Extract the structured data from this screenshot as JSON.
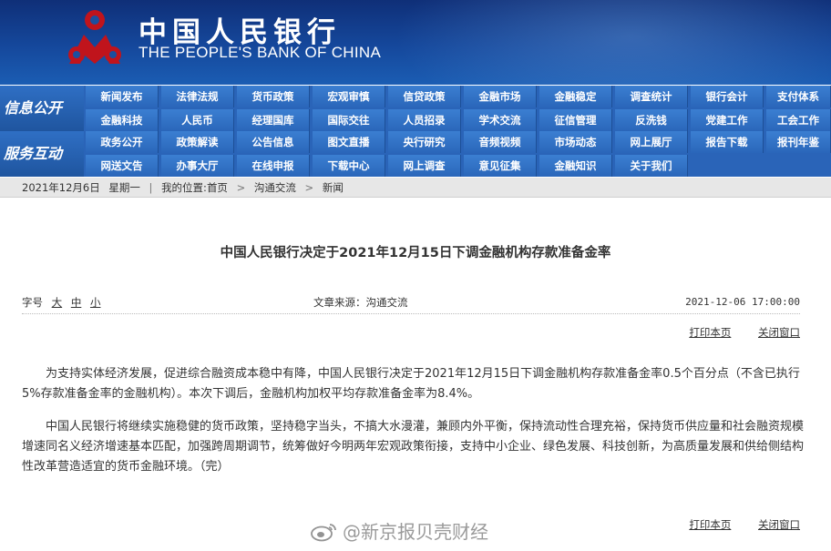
{
  "header": {
    "logo_cn": "中国人民银行",
    "logo_en": "THE PEOPLE'S BANK OF CHINA",
    "emblem_icon": "pboc-emblem-icon",
    "brand_color": "#c0141c",
    "banner_color": "#15489c"
  },
  "nav": {
    "sections": [
      {
        "title": "信息公开",
        "rows": [
          [
            "新闻发布",
            "法律法规",
            "货币政策",
            "宏观审慎",
            "信贷政策",
            "金融市场",
            "金融稳定",
            "调查统计",
            "银行会计",
            "支付体系"
          ],
          [
            "金融科技",
            "人民币",
            "经理国库",
            "国际交往",
            "人员招录",
            "学术交流",
            "征信管理",
            "反洗钱",
            "党建工作",
            "工会工作"
          ]
        ]
      },
      {
        "title": "服务互动",
        "rows": [
          [
            "政务公开",
            "政策解读",
            "公告信息",
            "图文直播",
            "央行研究",
            "音频视频",
            "市场动态",
            "网上展厅",
            "报告下载",
            "报刊年鉴"
          ],
          [
            "网送文告",
            "办事大厅",
            "在线申报",
            "下载中心",
            "网上调查",
            "意见征集",
            "金融知识",
            "关于我们"
          ]
        ]
      }
    ]
  },
  "breadcrumb": {
    "date": "2021年12月6日",
    "weekday": "星期一",
    "location_label": "我的位置:",
    "home": "首页",
    "section": "沟通交流",
    "page": "新闻"
  },
  "article": {
    "title": "中国人民银行决定于2021年12月15日下调金融机构存款准备金率",
    "font_size_label": "字号",
    "font_sizes": [
      "大",
      "中",
      "小"
    ],
    "source": "文章来源：沟通交流",
    "timestamp": "2021-12-06 17:00:00",
    "print_label": "打印本页",
    "close_label": "关闭窗口",
    "paragraphs": [
      "为支持实体经济发展，促进综合融资成本稳中有降，中国人民银行决定于2021年12月15日下调金融机构存款准备金率0.5个百分点（不含已执行5%存款准备金率的金融机构）。本次下调后，金融机构加权平均存款准备金率为8.4%。",
      "中国人民银行将继续实施稳健的货币政策，坚持稳字当头，不搞大水漫灌，兼顾内外平衡，保持流动性合理充裕，保持货币供应量和社会融资规模增速同名义经济增速基本匹配，加强跨周期调节，统筹做好今明两年宏观政策衔接，支持中小企业、绿色发展、科技创新，为高质量发展和供给侧结构性改革营造适宜的货币金融环境。（完）"
    ]
  },
  "watermark": {
    "text": "@新京报贝壳财经",
    "icon": "weibo-icon"
  }
}
